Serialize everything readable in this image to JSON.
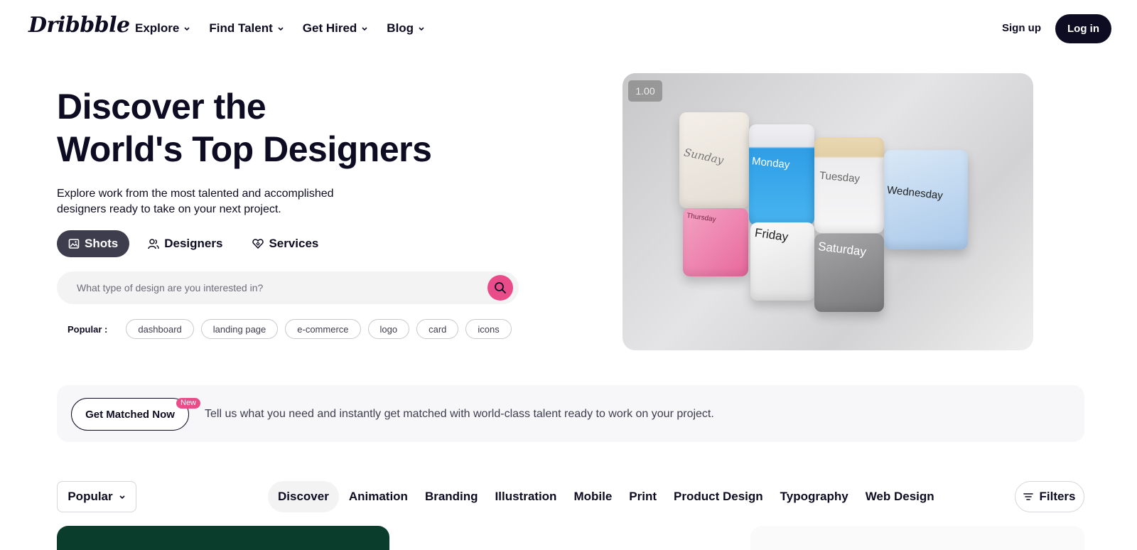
{
  "header": {
    "logo": "Dribbble",
    "nav": [
      {
        "label": "Explore"
      },
      {
        "label": "Find Talent"
      },
      {
        "label": "Get Hired"
      },
      {
        "label": "Blog"
      }
    ],
    "signup_label": "Sign up",
    "login_label": "Log in"
  },
  "hero": {
    "title_line1": "Discover the",
    "title_line2": "World's Top Designers",
    "subtitle": "Explore work from the most talented and accomplished designers ready to take on your next project.",
    "segments": [
      {
        "label": "Shots",
        "icon": "image-icon",
        "active": true
      },
      {
        "label": "Designers",
        "icon": "users-icon",
        "active": false
      },
      {
        "label": "Services",
        "icon": "heart-diamond-icon",
        "active": false
      }
    ],
    "search": {
      "placeholder": "What type of design are you interested in?",
      "value": ""
    },
    "popular_label": "Popular :",
    "popular_tags": [
      "dashboard",
      "landing page",
      "e-commerce",
      "logo",
      "card",
      "icons"
    ]
  },
  "media": {
    "playback_speed": "1.00",
    "days": [
      "Sunday",
      "Monday",
      "Tuesday",
      "Wednesday",
      "Thursday",
      "Friday",
      "Saturday"
    ]
  },
  "banner": {
    "button_label": "Get Matched Now",
    "badge": "New",
    "text": "Tell us what you need and instantly get matched with world-class talent ready to work on your project."
  },
  "filterbar": {
    "sort_value": "Popular",
    "categories": [
      "Discover",
      "Animation",
      "Branding",
      "Illustration",
      "Mobile",
      "Print",
      "Product Design",
      "Typography",
      "Web Design"
    ],
    "active_category": "Discover",
    "filters_label": "Filters"
  },
  "colors": {
    "brand_pink": "#ea4c89",
    "ink": "#0d0c22",
    "segment_active": "#3d3d4e"
  }
}
